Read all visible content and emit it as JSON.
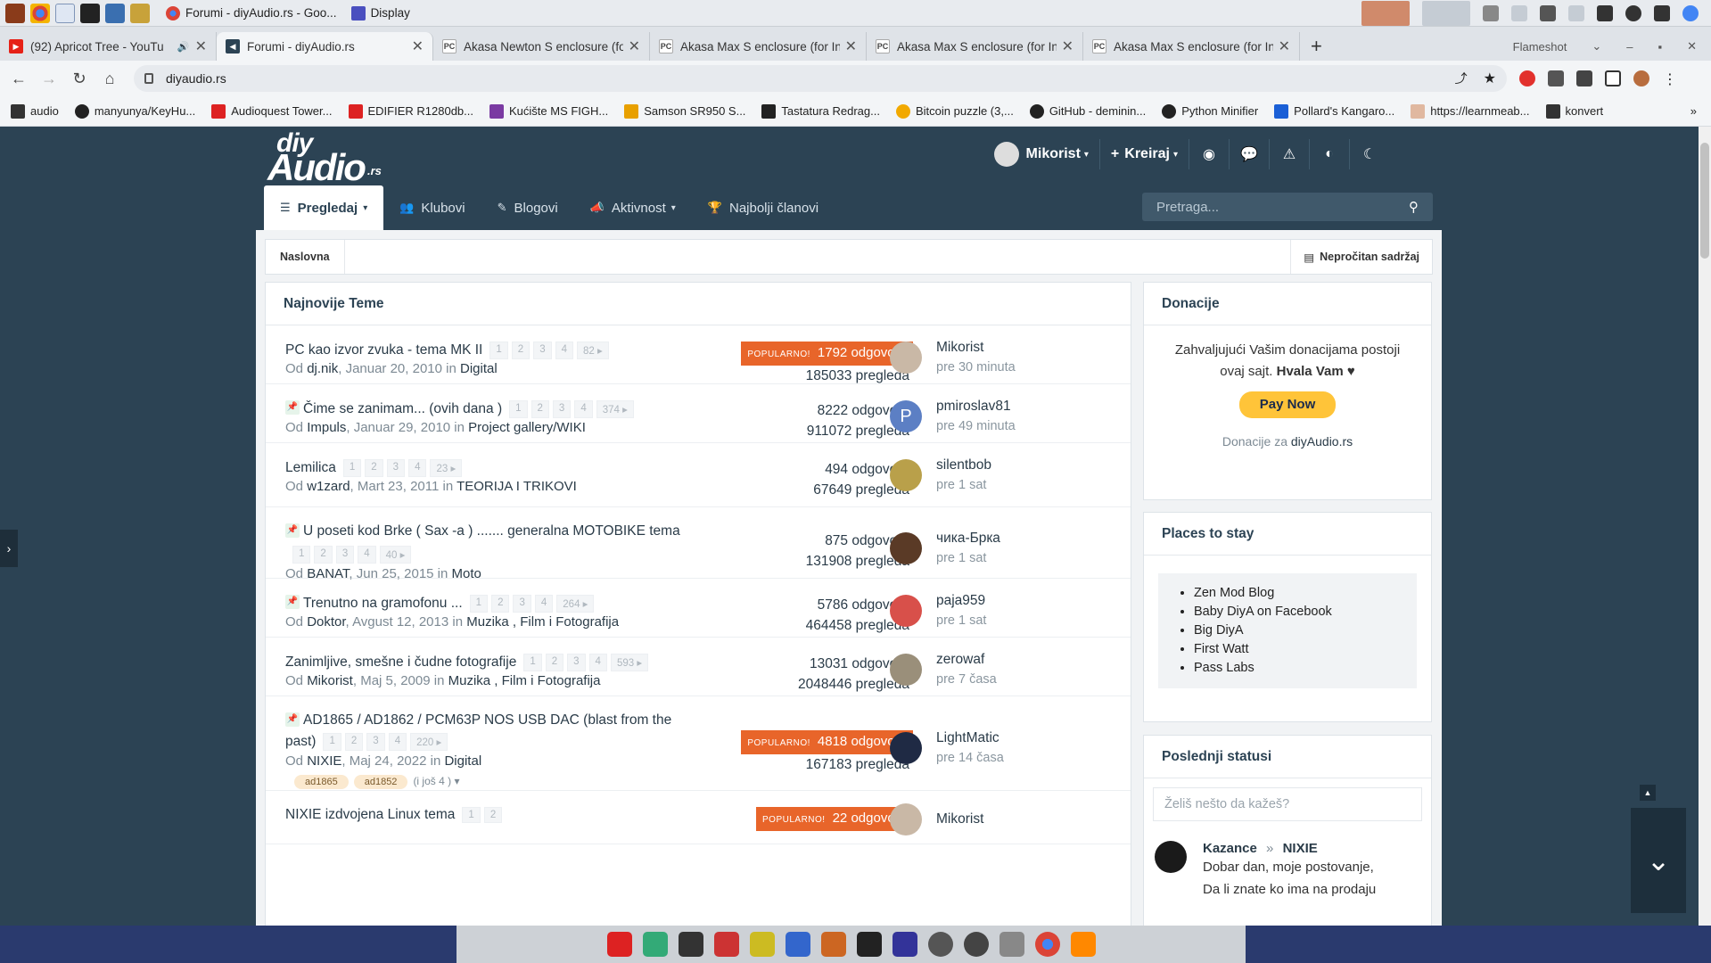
{
  "taskbar": {
    "windows": [
      {
        "title": "Forumi - diyAudio.rs - Goo..."
      },
      {
        "title": "Display"
      }
    ]
  },
  "browser": {
    "tabs": [
      {
        "label": "(92) Apricot Tree - YouTu",
        "fav": "YT"
      },
      {
        "label": "Forumi - diyAudio.rs",
        "fav": "dA",
        "active": true
      },
      {
        "label": "Akasa Newton S enclosure (fo",
        "fav": "PC"
      },
      {
        "label": "Akasa Max S enclosure (for Int",
        "fav": "PC"
      },
      {
        "label": "Akasa Max S enclosure (for Int",
        "fav": "PC"
      },
      {
        "label": "Akasa Max S enclosure (for Int",
        "fav": "PC"
      }
    ],
    "new_tab": "+",
    "flameshot": "Flameshot",
    "url": "diyaudio.rs",
    "bookmarks": [
      "audio",
      "manyunya/KeyHu...",
      "Audioquest Tower...",
      "EDIFIER R1280db...",
      "Kućište MS FIGH...",
      "Samson SR950 S...",
      "Tastatura Redrag...",
      "Bitcoin puzzle (3,...",
      "GitHub - deminin...",
      "Python Minifier",
      "Pollard's Kangaro...",
      "https://learnmeab...",
      "konvert"
    ],
    "bookmarks_more": "»"
  },
  "site": {
    "logo_top": "diy",
    "logo_bottom": "Audio",
    "logo_suffix": ".rs",
    "user": "Mikorist",
    "create": "Kreiraj",
    "nav": [
      {
        "label": "Pregledaj",
        "icon": "☰",
        "active": true
      },
      {
        "label": "Klubovi",
        "icon": "👥"
      },
      {
        "label": "Blogovi",
        "icon": "✎"
      },
      {
        "label": "Aktivnost",
        "icon": "📣"
      },
      {
        "label": "Najbolji članovi",
        "icon": "🏆"
      }
    ],
    "search_placeholder": "Pretraga...",
    "breadcrumb": "Naslovna",
    "unread": "Nepročitan sadržaj",
    "threads_title": "Najnovije Teme",
    "popular_label": "POPULARNO!",
    "threads": [
      {
        "title": "PC kao izvor zvuka - tema MK II",
        "pages": [
          "1",
          "2",
          "3",
          "4",
          "82 ▸"
        ],
        "author": "dj.nik",
        "date": "Januar 20, 2010",
        "forum": "Digital",
        "replies": "1792 odgovora",
        "views": "185033 pregleda",
        "popular": true,
        "last_user": "Mikorist",
        "last_time": "pre 30 minuta",
        "av": "#c9b8a6"
      },
      {
        "title": "Čime se zanimam... (ovih dana )",
        "pages": [
          "1",
          "2",
          "3",
          "4",
          "374 ▸"
        ],
        "author": "Impuls",
        "date": "Januar 29, 2010",
        "forum": "Project gallery/WIKI",
        "replies": "8222 odgovora",
        "views": "911072 pregleda",
        "pinned": true,
        "last_user": "pmiroslav81",
        "last_time": "pre 49 minuta",
        "av": "#5c7fc4",
        "av_letter": "P"
      },
      {
        "title": "Lemilica",
        "pages": [
          "1",
          "2",
          "3",
          "4",
          "23 ▸"
        ],
        "author": "w1zard",
        "date": "Mart 23, 2011",
        "forum": "TEORIJA I TRIKOVI",
        "replies": "494 odgovora",
        "views": "67649 pregleda",
        "last_user": "silentbob",
        "last_time": "pre 1 sat",
        "av": "#b9a04a"
      },
      {
        "title": "U poseti kod Brke ( Sax -a ) ....... generalna MOTOBIKE tema",
        "pages": [
          "1",
          "2",
          "3",
          "4",
          "40 ▸"
        ],
        "author": "BANAT",
        "date": "Jun 25, 2015",
        "forum": "Moto",
        "replies": "875 odgovora",
        "views": "131908 pregleda",
        "pinned": true,
        "last_user": "чика-Бркa",
        "last_time": "pre 1 sat",
        "av": "#5a3a26"
      },
      {
        "title": "Trenutno na gramofonu ...",
        "pages": [
          "1",
          "2",
          "3",
          "4",
          "264 ▸"
        ],
        "author": "Doktor",
        "date": "Avgust 12, 2013",
        "forum": "Muzika , Film i Fotografija",
        "replies": "5786 odgovora",
        "views": "464458 pregleda",
        "pinned": true,
        "last_user": "paja959",
        "last_time": "pre 1 sat",
        "av": "#d8504a"
      },
      {
        "title": "Zanimljive, smešne i čudne fotografije",
        "pages": [
          "1",
          "2",
          "3",
          "4",
          "593 ▸"
        ],
        "author": "Mikorist",
        "date": "Maj 5, 2009",
        "forum": "Muzika , Film i Fotografija",
        "replies": "13031 odgovora",
        "views": "2048446 pregleda",
        "last_user": "zerowaf",
        "last_time": "pre 7 časa",
        "av": "#9a8f7a"
      },
      {
        "title": "AD1865 / AD1862 / PCM63P NOS USB DAC (blast from the",
        "title2": "past)",
        "pages": [
          "1",
          "2",
          "3",
          "4",
          "220 ▸"
        ],
        "author": "NIXIE",
        "date": "Maj 24, 2022",
        "forum": "Digital",
        "replies": "4818 odgovora",
        "views": "167183 pregleda",
        "popular": true,
        "pinned": true,
        "last_user": "LightMatic",
        "last_time": "pre 14 časa",
        "av": "#1f2a44",
        "tags": [
          "ad1865",
          "ad1852"
        ],
        "more_tags": "(i još 4 ) ▾"
      },
      {
        "title": "NIXIE izdvojena Linux tema",
        "pages": [
          "1",
          "2"
        ],
        "replies": "22 odgovora",
        "popular": true,
        "last_user": "Mikorist",
        "av": "#c9b8a6"
      }
    ],
    "donations": {
      "title": "Donacije",
      "text1": "Zahvaljujući Vašim donacijama postoji ovaj sajt.",
      "text_bold": "Hvala Vam ♥",
      "paynow": "Pay Now",
      "footer": "Donacije za",
      "footer_link": "diyAudio.rs"
    },
    "places": {
      "title": "Places to stay",
      "items": [
        "Zen Mod Blog",
        "Baby DiyA on Facebook",
        "Big DiyA",
        "First Watt",
        "Pass Labs"
      ]
    },
    "statuses": {
      "title": "Poslednji statusi",
      "placeholder": "Želiš nešto da kažeš?",
      "from": "Kazance",
      "arrow": "»",
      "to": "NIXIE",
      "line1": "Dobar dan, moje postovanje,",
      "line2": "Da li znate ko ima na prodaju"
    }
  }
}
